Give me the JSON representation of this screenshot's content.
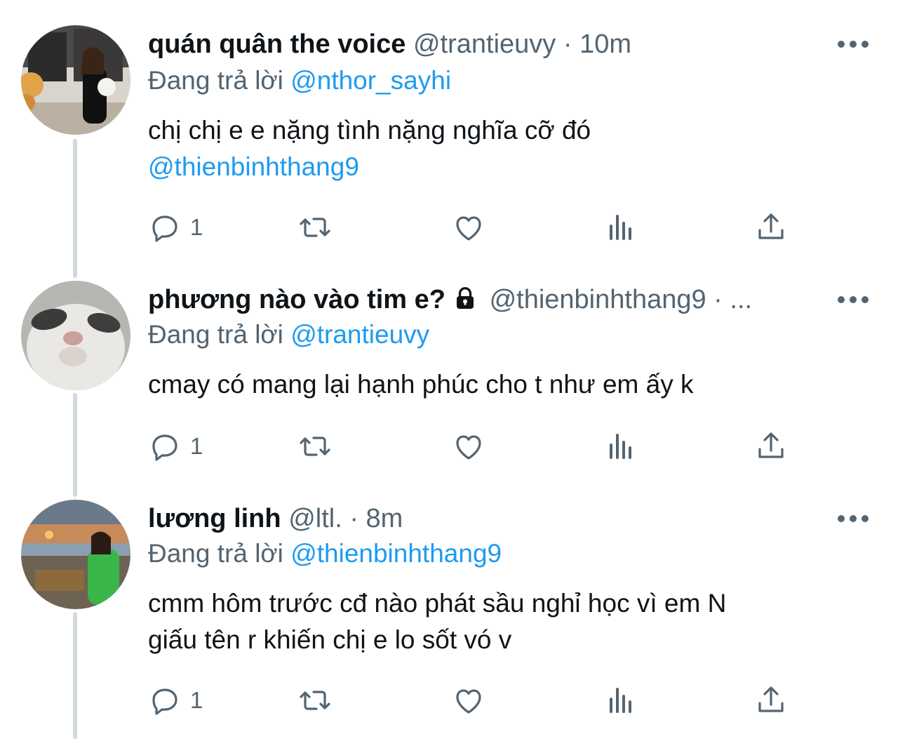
{
  "colors": {
    "text": "#0f1419",
    "secondary": "#536471",
    "link": "#1d9bf0",
    "thread_line": "#cfd9de"
  },
  "icons": {
    "reply": "reply-icon",
    "retweet": "retweet-icon",
    "like": "heart-icon",
    "views": "views-icon",
    "share": "share-icon",
    "more": "more-icon",
    "lock": "lock-icon"
  },
  "tweets": [
    {
      "display_name": "quán quân the voice",
      "handle": "@trantieuvy",
      "separator": "·",
      "time": "10m",
      "reply_prefix": "Đang trả lời",
      "reply_to": "@nthor_sayhi",
      "text_line1": "chị chị e e nặng tình nặng nghĩa cỡ đó",
      "text_mention": "@thienbinhthang9",
      "reply_count": "1"
    },
    {
      "display_name": "phương nào vào tim e?",
      "handle": "@thienbinhthang9",
      "separator": "·",
      "time": "...",
      "reply_prefix": "Đang trả lời",
      "reply_to": "@trantieuvy",
      "text_line1": "cmay có mang lại hạnh phúc cho t như em ấy k",
      "reply_count": "1"
    },
    {
      "display_name": "lương linh",
      "handle": "@ltl.",
      "separator": "·",
      "time": "8m",
      "reply_prefix": "Đang trả lời",
      "reply_to": "@thienbinhthang9",
      "text_line1": "cmm hôm trước cđ nào phát sầu nghỉ học vì em N",
      "text_line2": "giấu tên r khiến chị e lo sốt vó v",
      "reply_count": "1"
    }
  ]
}
